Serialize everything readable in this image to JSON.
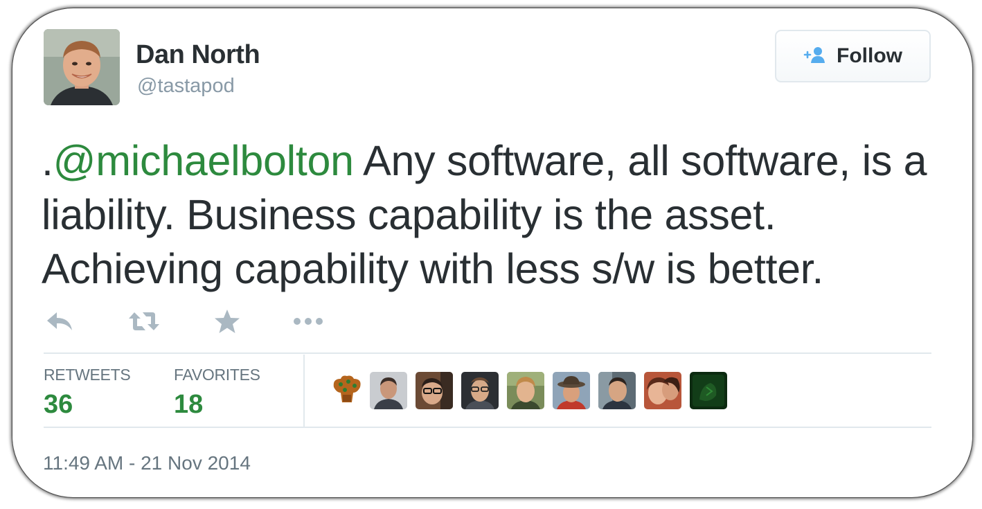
{
  "author": {
    "name": "Dan North",
    "handle": "@tastapod"
  },
  "follow_button": {
    "label": "Follow",
    "icon": "add-user-icon"
  },
  "tweet": {
    "prefix": ".",
    "mention": "@michaelbolton",
    "body": " Any software, all software, is a liability. Business capability is the asset. Achieving capability with less s/w is better."
  },
  "actions": [
    {
      "icon": "reply-icon"
    },
    {
      "icon": "retweet-icon"
    },
    {
      "icon": "favorite-star-icon"
    },
    {
      "icon": "more-icon"
    }
  ],
  "stats": {
    "retweets_label": "RETWEETS",
    "retweets_value": "36",
    "favorites_label": "FAVORITES",
    "favorites_value": "18"
  },
  "favorited_by_count_shown": 9,
  "timestamp": "11:49 AM - 21 Nov 2014",
  "colors": {
    "accent_green": "#2d8a3e",
    "text": "#292f33",
    "muted": "#8899a6",
    "follow_icon_blue": "#55acee"
  }
}
